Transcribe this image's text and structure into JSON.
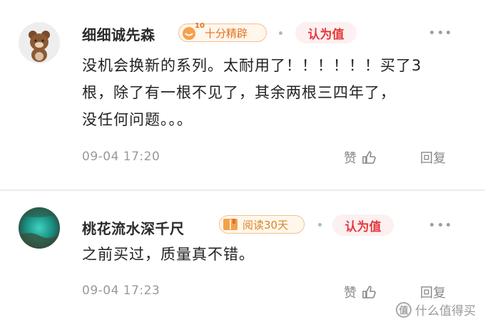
{
  "comments": [
    {
      "username": "细细诚先森",
      "badge": {
        "level": "10",
        "label": "十分精辟"
      },
      "worth_label": "认为值",
      "text_lines": [
        "没机会换新的系列。太耐用了！！！！！！买了3",
        "根，除了有一根不见了，其余两根三四年了，",
        "没任何问题。。。"
      ],
      "time": "09-04 17:20",
      "like_label": "赞",
      "reply_label": "回复"
    },
    {
      "username": "桃花流水深千尺",
      "badge": {
        "label": "阅读30天"
      },
      "worth_label": "认为值",
      "text_lines": [
        "之前买过，质量真不错。"
      ],
      "time": "09-04 17:23",
      "like_label": "赞",
      "reply_label": "回复"
    }
  ],
  "watermark": {
    "logo_char": "值",
    "text": "什么值得买"
  },
  "colors": {
    "accent_red": "#e4393c",
    "badge_orange": "#e5711f",
    "muted": "#999999"
  }
}
